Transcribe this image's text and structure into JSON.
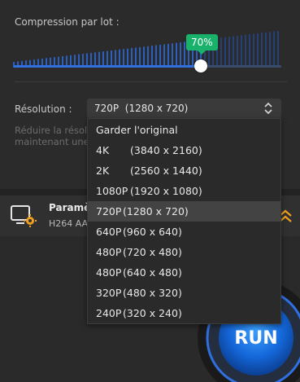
{
  "compression": {
    "label": "Compression par lot :",
    "value_label": "70%",
    "value": 0.7
  },
  "resolution": {
    "label": "Résolution :",
    "selected_name": "720P",
    "selected_dims": "(1280 x 720)",
    "hint_line1": "Réduire la résolu",
    "hint_line2": "maintenant une"
  },
  "dropdown": {
    "items": [
      {
        "name": "Garder l'original",
        "dims": ""
      },
      {
        "name": "4K",
        "dims": "(3840 x 2160)"
      },
      {
        "name": "2K",
        "dims": "(2560 x 1440)"
      },
      {
        "name": "1080P",
        "dims": "(1920 x 1080)"
      },
      {
        "name": "720P",
        "dims": "(1280 x 720)"
      },
      {
        "name": "640P",
        "dims": "(960 x 640)"
      },
      {
        "name": "480P",
        "dims": "(720 x 480)"
      },
      {
        "name": "480P",
        "dims": "(640 x 480)"
      },
      {
        "name": "320P",
        "dims": "(480 x 320)"
      },
      {
        "name": "240P",
        "dims": "(320 x 240)"
      }
    ],
    "selected_index": 4
  },
  "settings": {
    "title": "Paramè",
    "subtitle": "H264  AA"
  },
  "run_button": {
    "label": "RUN"
  },
  "colors": {
    "accent_blue": "#2f6fe0",
    "bubble_green": "#19b26b",
    "icon_orange": "#f0a020"
  },
  "icons": {
    "select_chevron": "chevron-up-down-icon",
    "settings": "monitor-gear-icon",
    "collapse": "double-chevron-up-icon"
  }
}
